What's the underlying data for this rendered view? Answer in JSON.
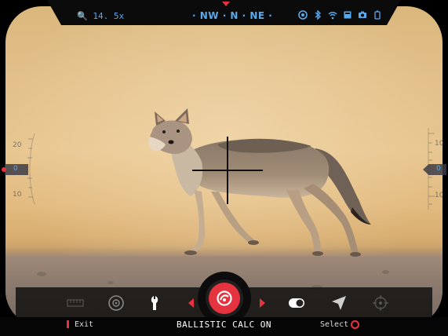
{
  "top_bar": {
    "zoom_label": "14. 5x",
    "compass_text": "· NW · N · NE ·",
    "status_icons": [
      "range-finder-icon",
      "bluetooth-icon",
      "wifi-icon",
      "sd-card-icon",
      "camera-icon",
      "battery-icon"
    ]
  },
  "left_gauge": {
    "values": [
      "20",
      "0",
      "10"
    ]
  },
  "right_gauge": {
    "values": [
      "10",
      "0",
      "10"
    ]
  },
  "toolbar": {
    "items": [
      {
        "icon": "ruler-icon"
      },
      {
        "icon": "reticle-icon"
      },
      {
        "icon": "wrench-icon"
      },
      {
        "icon": "ballistic-calc-icon",
        "selected": true
      },
      {
        "icon": "toggle-icon"
      },
      {
        "icon": "gps-arrow-icon"
      },
      {
        "icon": "target-icon"
      }
    ]
  },
  "bottom_bar": {
    "exit_label": "Exit",
    "status_text": "BALLISTIC CALC ON",
    "select_label": "Select"
  },
  "colors": {
    "accent": "#e5343f",
    "hud_blue": "#59a9ee",
    "frame": "#000000"
  }
}
